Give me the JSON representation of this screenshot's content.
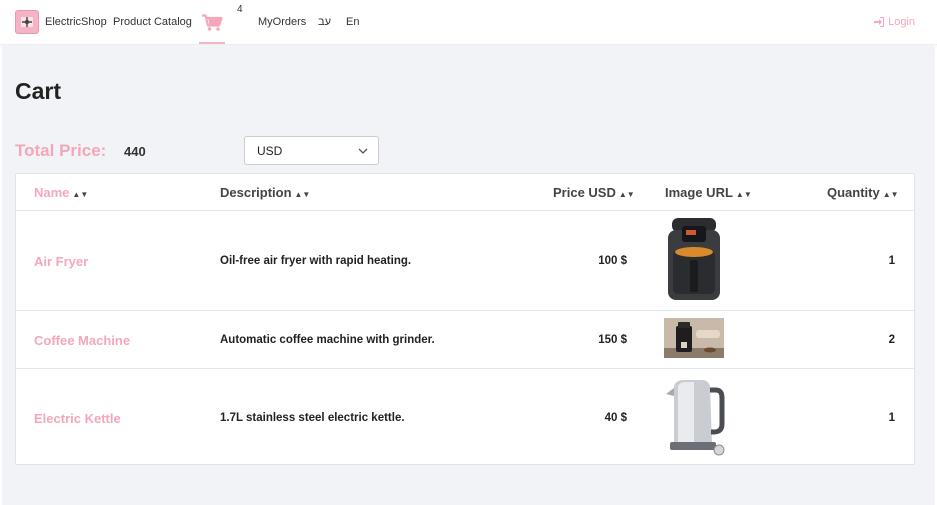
{
  "navbar": {
    "brand": "ElectricShop",
    "product_catalog": "Product Catalog",
    "cart_count": "4",
    "my_orders": "MyOrders",
    "lang_he": "עב",
    "lang_en": "En",
    "login": "Login"
  },
  "page": {
    "title": "Cart",
    "total_label": "Total Price:",
    "total_value": "440",
    "currency": "USD"
  },
  "table": {
    "headers": {
      "name": "Name",
      "description": "Description",
      "price": "Price USD",
      "image": "Image URL",
      "quantity": "Quantity"
    },
    "rows": [
      {
        "name": "Air Fryer",
        "description": "Oil-free air fryer with rapid heating.",
        "price": "100 $",
        "image": "air-fryer-image",
        "quantity": "1"
      },
      {
        "name": "Coffee Machine",
        "description": "Automatic coffee machine with grinder.",
        "price": "150 $",
        "image": "coffee-machine-image",
        "quantity": "2"
      },
      {
        "name": "Electric Kettle",
        "description": "1.7L stainless steel electric kettle.",
        "price": "40 $",
        "image": "electric-kettle-image",
        "quantity": "1"
      }
    ]
  },
  "colors": {
    "accent": "#f4a7ba",
    "background": "#f1f3f6"
  }
}
